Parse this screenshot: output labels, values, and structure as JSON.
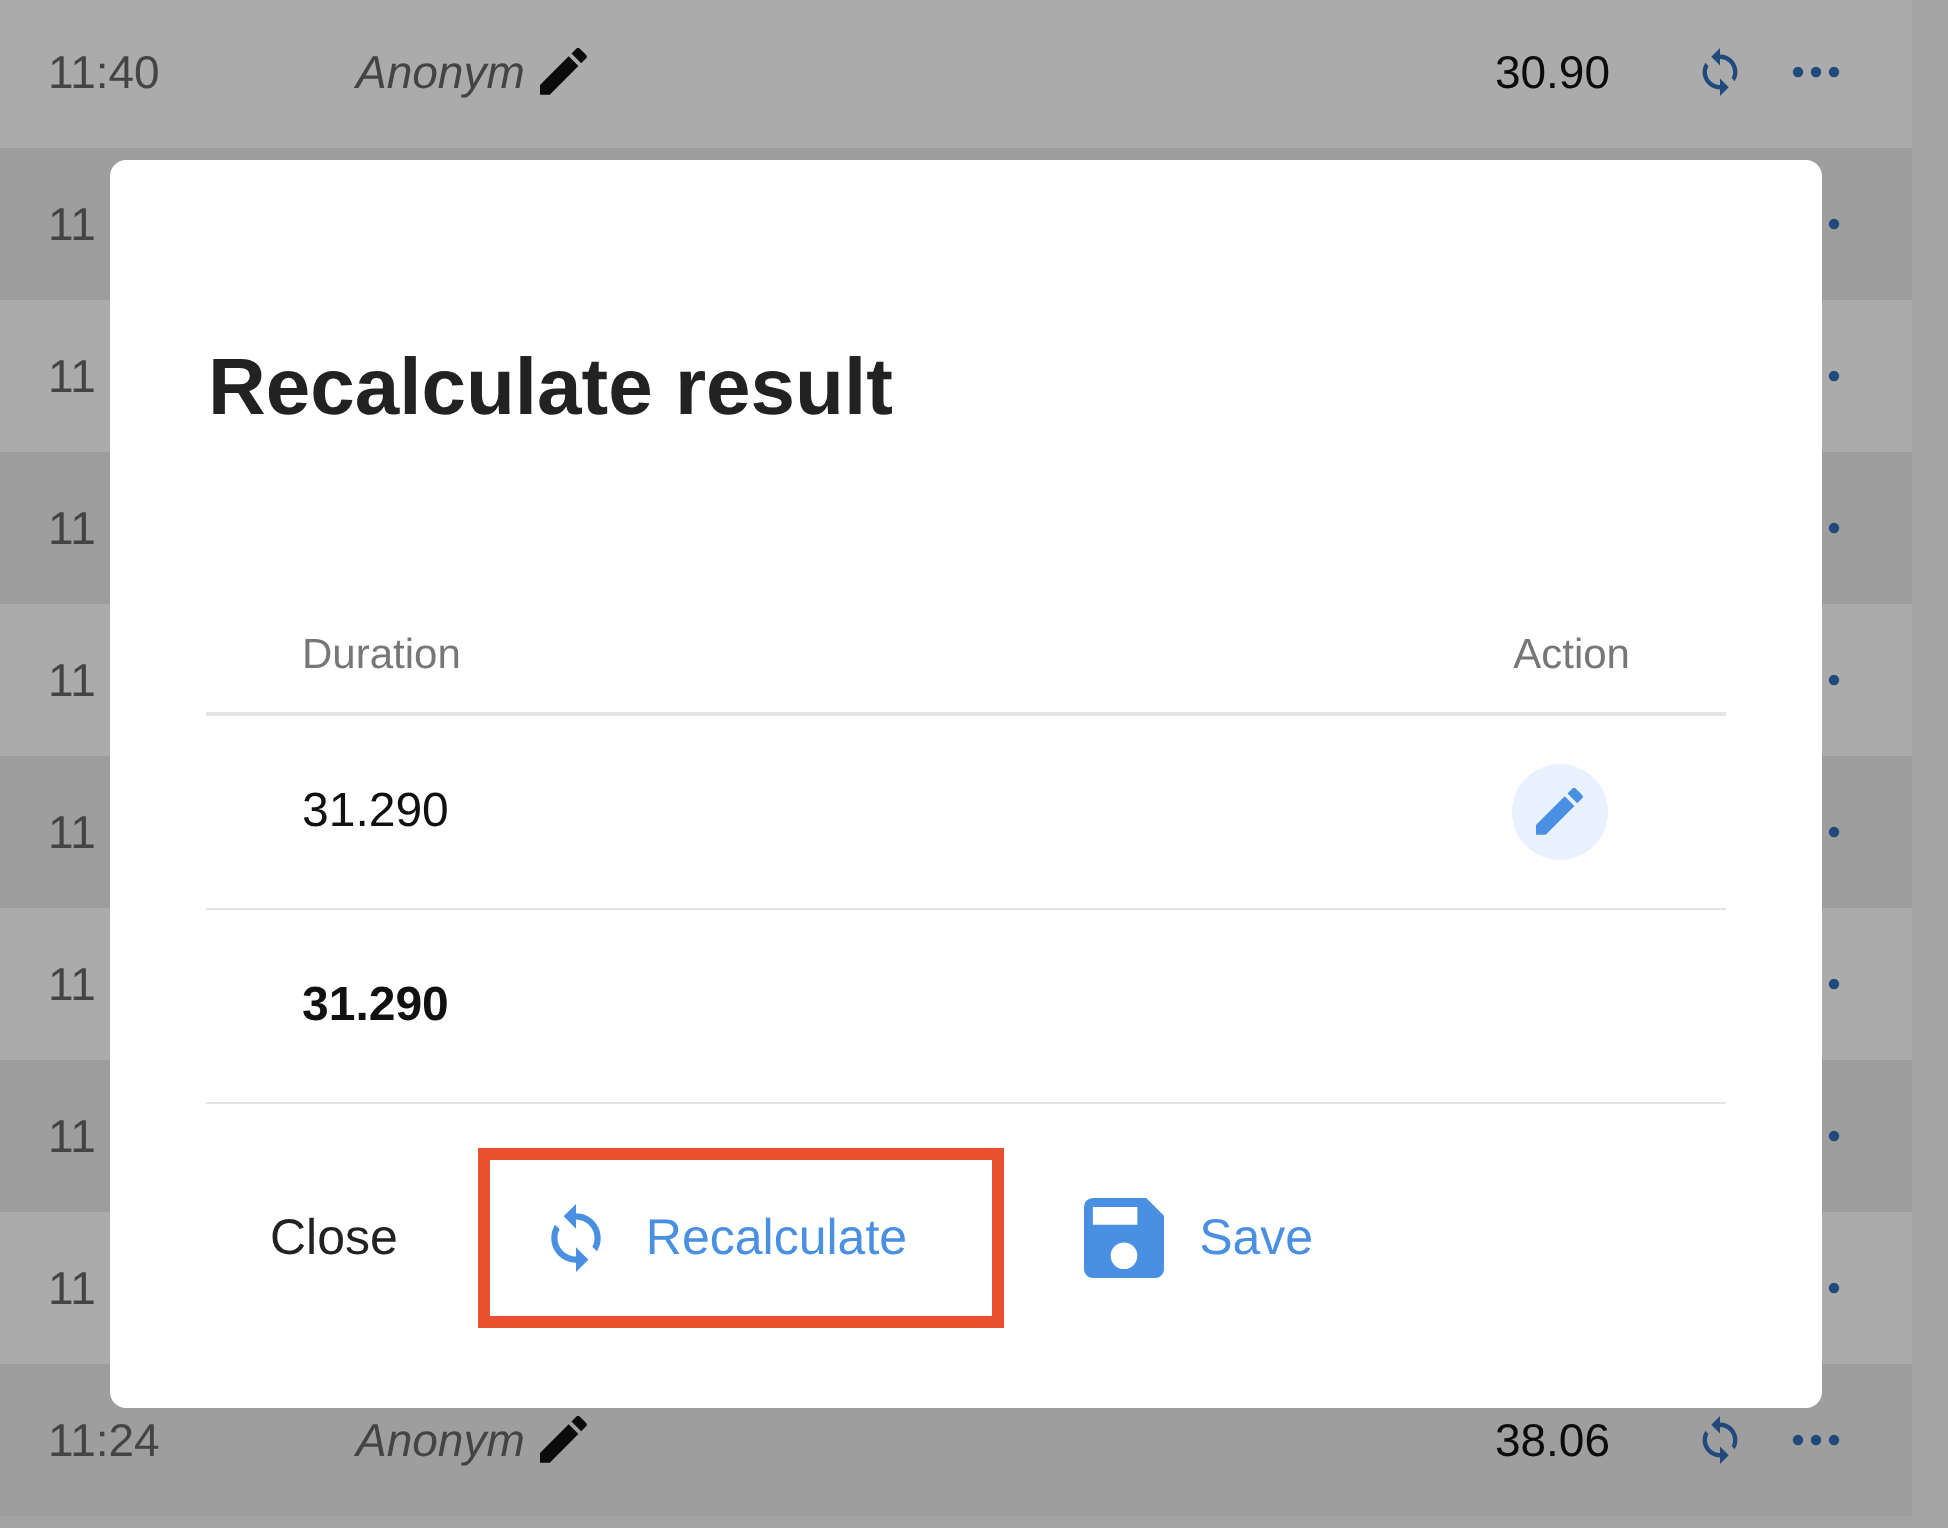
{
  "background_rows": [
    {
      "kind": "full",
      "time": "11:40",
      "name": "Anonym",
      "value": "30.90"
    },
    {
      "kind": "covered",
      "time": "11"
    },
    {
      "kind": "covered",
      "time": "11"
    },
    {
      "kind": "covered",
      "time": "11"
    },
    {
      "kind": "covered",
      "time": "11"
    },
    {
      "kind": "covered",
      "time": "11"
    },
    {
      "kind": "covered",
      "time": "11"
    },
    {
      "kind": "covered",
      "time": "11"
    },
    {
      "kind": "covered",
      "time": "11"
    },
    {
      "kind": "full",
      "time": "11:24",
      "name": "Anonym",
      "value": "38.06"
    }
  ],
  "dialog": {
    "title": "Recalculate result",
    "columns": [
      "Duration",
      "Action"
    ],
    "rows": [
      {
        "kind": "editable",
        "duration": "31.290"
      },
      {
        "kind": "total",
        "duration": "31.290"
      }
    ],
    "buttons": [
      {
        "kind": "plain",
        "label": "Close",
        "highlighted": false
      },
      {
        "kind": "recalculate",
        "label": "Recalculate",
        "highlighted": true
      },
      {
        "kind": "save",
        "label": "Save",
        "highlighted": false
      }
    ]
  }
}
